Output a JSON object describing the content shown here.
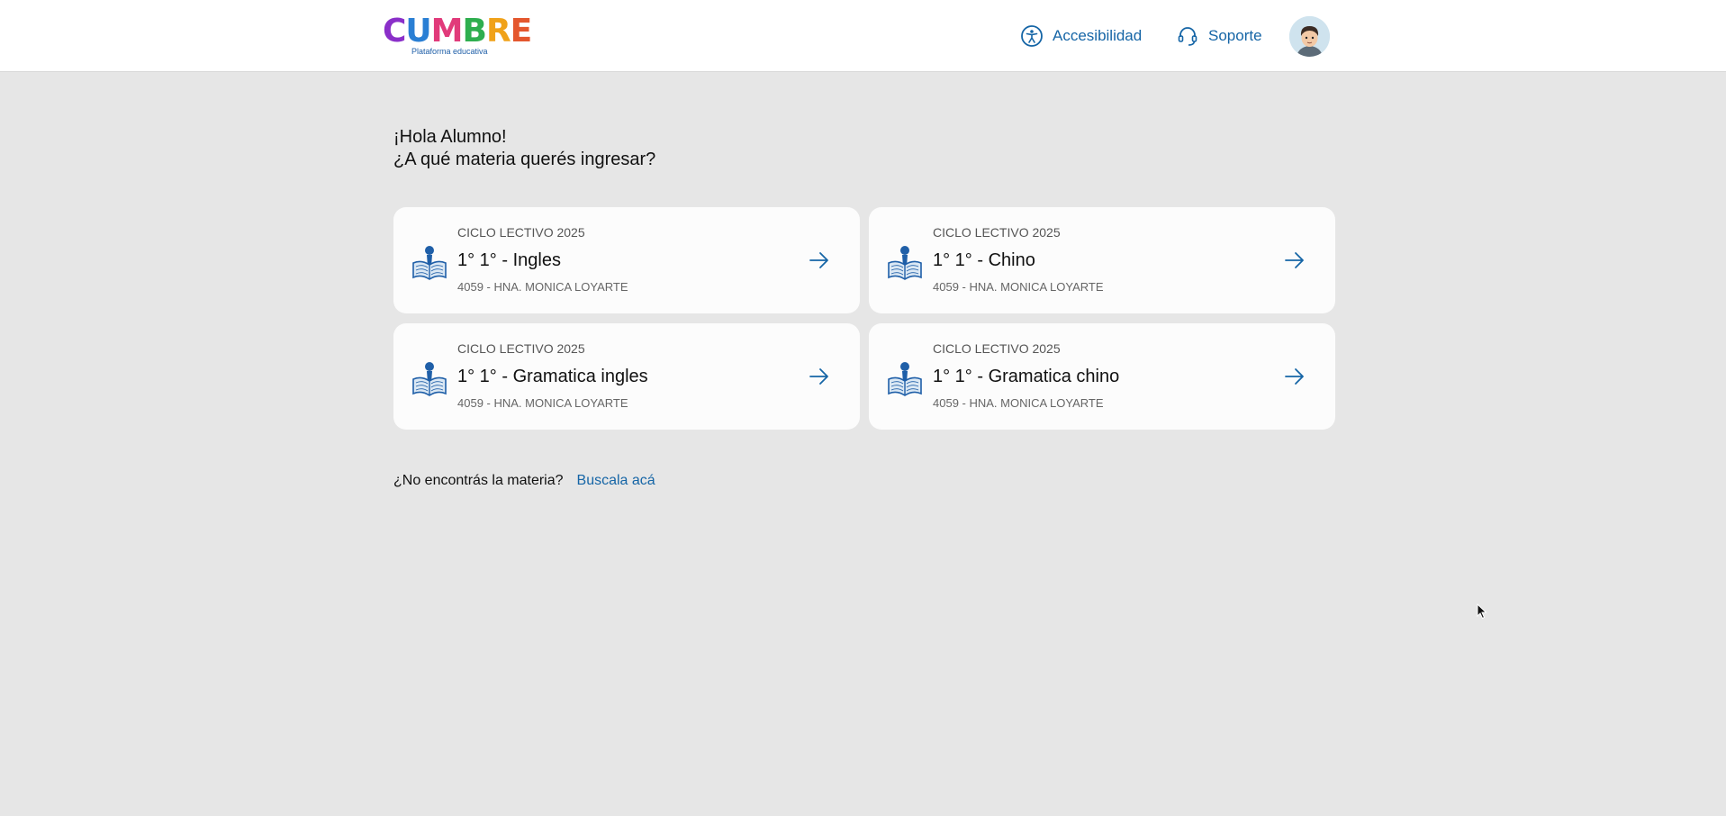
{
  "header": {
    "logo_letters": [
      "C",
      "U",
      "M",
      "B",
      "R",
      "E"
    ],
    "logo_subtitle": "Plataforma educativa",
    "accessibility_label": "Accesibilidad",
    "support_label": "Soporte"
  },
  "greeting": {
    "line1": "¡Hola Alumno!",
    "line2": "¿A qué materia querés ingresar?"
  },
  "subjects": [
    {
      "cycle": "CICLO LECTIVO 2025",
      "title": "1° 1° - Ingles",
      "school": "4059 - HNA. MONICA LOYARTE"
    },
    {
      "cycle": "CICLO LECTIVO 2025",
      "title": "1° 1° - Chino",
      "school": "4059 - HNA. MONICA LOYARTE"
    },
    {
      "cycle": "CICLO LECTIVO 2025",
      "title": "1° 1° - Gramatica ingles",
      "school": "4059 - HNA. MONICA LOYARTE"
    },
    {
      "cycle": "CICLO LECTIVO 2025",
      "title": "1° 1° - Gramatica chino",
      "school": "4059 - HNA. MONICA LOYARTE"
    }
  ],
  "footer": {
    "question": "¿No encontrás la materia?",
    "link_label": "Buscala acá"
  },
  "colors": {
    "accent": "#1565a6",
    "background": "#e6e6e6",
    "card": "#fcfcfc"
  },
  "icons": {
    "book": "book-reader-icon",
    "arrow": "arrow-right-icon",
    "accessibility": "accessibility-icon",
    "support": "headset-icon"
  }
}
